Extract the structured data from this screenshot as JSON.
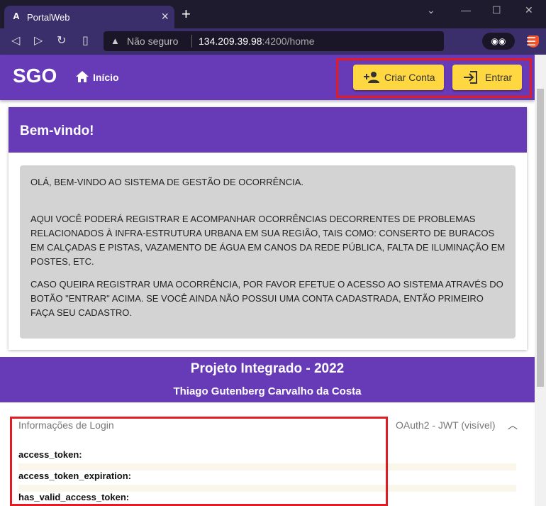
{
  "browser": {
    "tab_title": "PortalWeb",
    "new_tab": "+",
    "url_security": "Não seguro",
    "url_host": "134.209.39.98",
    "url_path": ":4200/home"
  },
  "app": {
    "logo": "SGO",
    "home_label": "Início",
    "create_account_label": "Criar Conta",
    "login_label": "Entrar"
  },
  "welcome": {
    "title": "Bem-vindo!",
    "p1": "OLÁ, BEM-VINDO AO SISTEMA DE GESTÃO DE OCORRÊNCIA.",
    "p2": "AQUI VOCÊ PODERÁ REGISTRAR E ACOMPANHAR OCORRÊNCIAS DECORRENTES DE PROBLEMAS RELACIONADOS À INFRA-ESTRUTURA URBANA EM SUA REGIÃO, TAIS COMO: CONSERTO DE BURACOS EM CALÇADAS E PISTAS, VAZAMENTO DE ÁGUA EM CANOS DA REDE PÚBLICA, FALTA DE ILUMINAÇÃO EM POSTES, ETC.",
    "p3": "CASO QUEIRA REGISTRAR UMA OCORRÊNCIA, POR FAVOR EFETUE O ACESSO AO SISTEMA ATRAVÉS DO BOTÃO \"ENTRAR\" ACIMA. SE VOCÊ AINDA NÃO POSSUI UMA CONTA CADASTRADA, ENTÃO PRIMEIRO FAÇA SEU CADASTRO."
  },
  "footer": {
    "project": "Projeto Integrado - 2022",
    "author": "Thiago Gutenberg Carvalho da Costa"
  },
  "login_info": {
    "title": "Informações de Login",
    "description": "OAuth2 - JWT (visível)",
    "fields": [
      "access_token:",
      "access_token_expiration:",
      "has_valid_access_token:"
    ]
  },
  "colors": {
    "primary": "#673ab7",
    "accent": "#ffd740",
    "highlight": "#e21b24"
  }
}
